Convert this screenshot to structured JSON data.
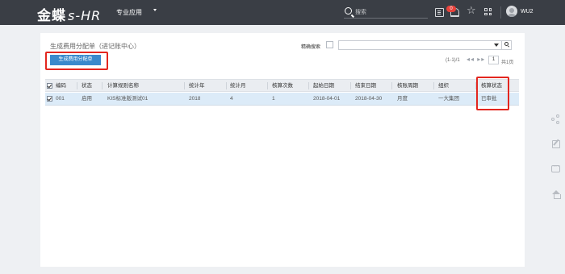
{
  "app": {
    "brand": "金蝶",
    "product": "s-HR",
    "menu_label": "专业应用",
    "search_placeholder": "搜索",
    "notification_count": "0",
    "username": "WU2"
  },
  "page": {
    "title": "生成费用分配单（进记账中心）",
    "precise_search_label": "精确搜索",
    "filter_value": "",
    "generate_button": "生成费用分配单",
    "pager_count": "(1-1)/1",
    "pager_arrows": "◂◂ ▸▸",
    "page_number": "1",
    "page_total": "共1页"
  },
  "table": {
    "columns": [
      "编码",
      "状态",
      "计算规则名称",
      "统计年",
      "统计月",
      "核算次数",
      "起始日期",
      "结束日期",
      "核账周期",
      "组织",
      "核算状态"
    ],
    "rows": [
      [
        "001",
        "启用",
        "KIS标准版测试01",
        "2018",
        "4",
        "1",
        "2018-04-01",
        "2018-04-30",
        "月度",
        "一大集团",
        "已审批"
      ]
    ]
  },
  "icons": {
    "topbar": [
      "search-icon",
      "document-icon",
      "bell-icon",
      "star-icon",
      "grid-icon",
      "avatar"
    ],
    "side": [
      "share-icon",
      "edit-icon",
      "chat-icon",
      "home-icon"
    ]
  },
  "colors": {
    "topbar": "#3a3e45",
    "primary_button": "#3a89cc",
    "highlight": "#e3261f",
    "selected_row": "#dcebf8",
    "badge": "#e8433c"
  }
}
